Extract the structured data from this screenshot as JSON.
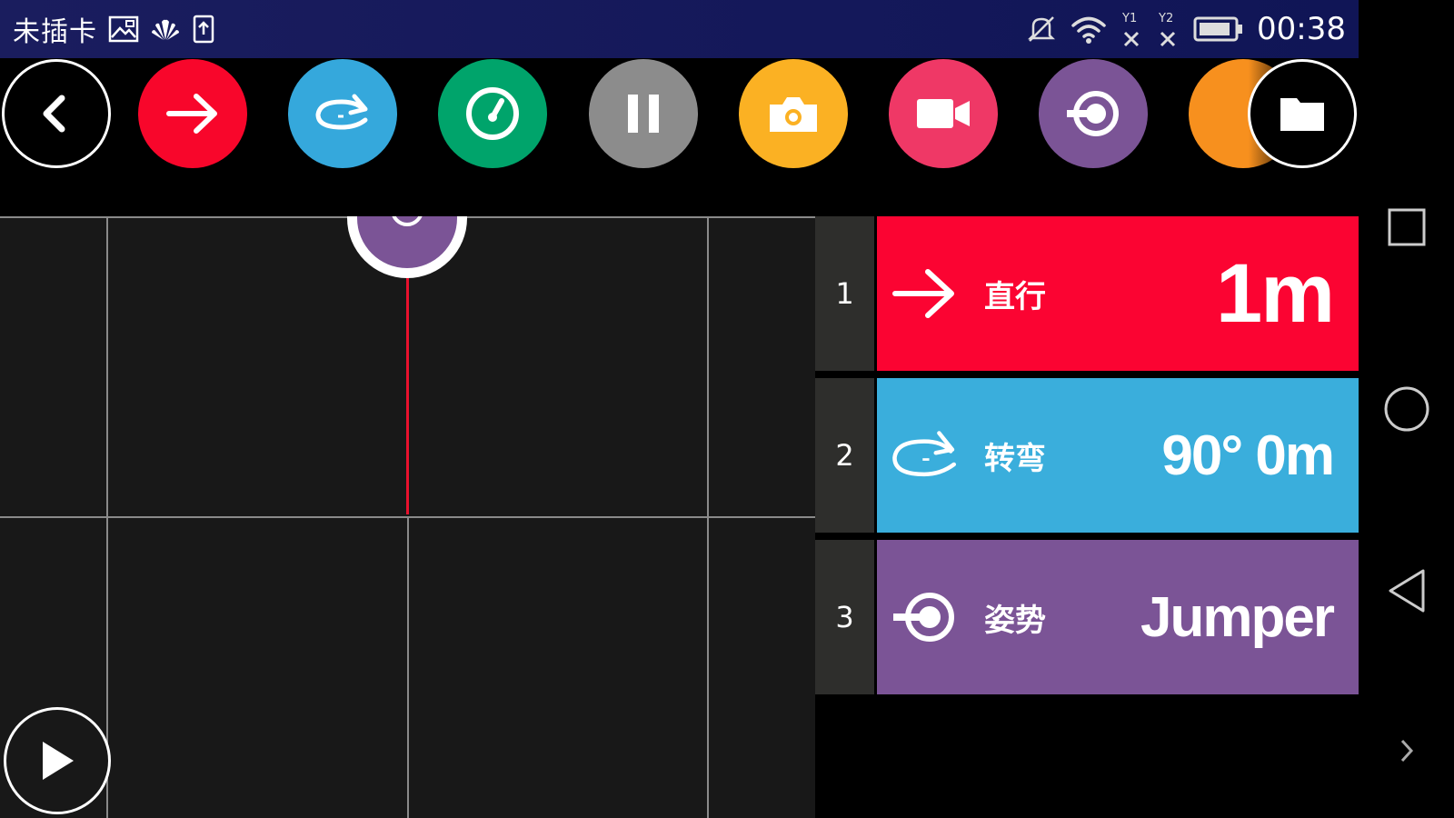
{
  "status_bar": {
    "carrier": "未插卡",
    "time": "00:38",
    "sim1": "1",
    "sim2": "2"
  },
  "toolbar": {
    "buttons": [
      {
        "name": "back",
        "icon": "chevron-left-icon",
        "color": "#000000"
      },
      {
        "name": "straight",
        "icon": "arrow-right-icon",
        "color": "#f8062b"
      },
      {
        "name": "turn",
        "icon": "turn-arrow-icon",
        "color": "#35a8dc"
      },
      {
        "name": "speed",
        "icon": "speedometer-icon",
        "color": "#00a46b"
      },
      {
        "name": "pause",
        "icon": "pause-icon",
        "color": "#8c8c8c"
      },
      {
        "name": "camera",
        "icon": "camera-icon",
        "color": "#fbb123"
      },
      {
        "name": "video",
        "icon": "video-camera-icon",
        "color": "#ef3866"
      },
      {
        "name": "posture",
        "icon": "posture-icon",
        "color": "#7b5496"
      },
      {
        "name": "more",
        "icon": "partial-orange-icon",
        "color": "#f7901e"
      },
      {
        "name": "folder",
        "icon": "folder-icon",
        "color": "#000000"
      }
    ]
  },
  "commands": [
    {
      "index": "1",
      "label": "直行",
      "value": "1m",
      "color": "#fb0432",
      "icon": "arrow-right-icon"
    },
    {
      "index": "2",
      "label": "转弯",
      "value": "90° 0m",
      "color": "#3aaedc",
      "icon": "turn-arrow-icon"
    },
    {
      "index": "3",
      "label": "姿势",
      "value": "Jumper",
      "color": "#7b5496",
      "icon": "posture-icon"
    }
  ],
  "colors": {
    "map_bg": "#181818",
    "grid": "#8a8a8a",
    "path": "#e8112d",
    "status_bar": "#14185a"
  }
}
